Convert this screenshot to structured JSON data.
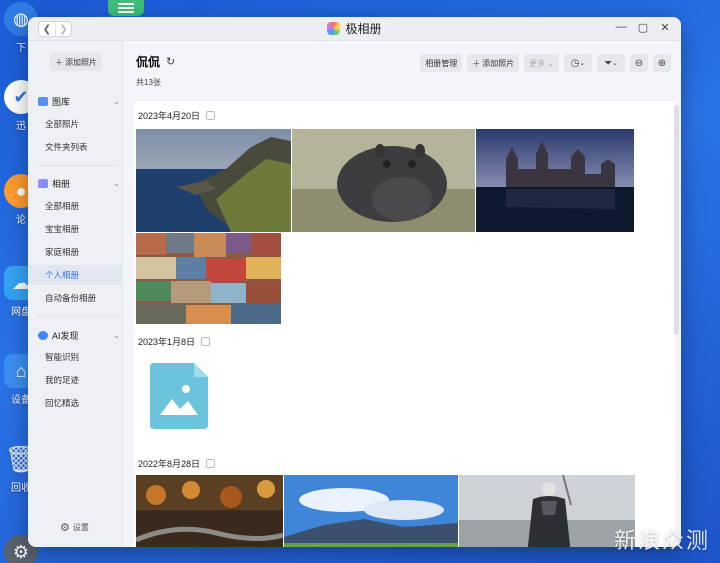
{
  "desktop": {
    "icons": [
      {
        "label": "下"
      },
      {
        "label": "迅"
      },
      {
        "label": "论"
      },
      {
        "label": "网盘"
      },
      {
        "label": "设备"
      },
      {
        "label": "回收"
      }
    ]
  },
  "window": {
    "title": "极相册",
    "controls": {
      "minimize": "—",
      "maximize": "▢",
      "close": "✕"
    }
  },
  "sidebar": {
    "add_photo": "添加照片",
    "gallery": {
      "title": "图库",
      "items": [
        "全部照片",
        "文件夹列表"
      ]
    },
    "albums": {
      "title": "相册",
      "items": [
        "全部相册",
        "宝宝相册",
        "家庭相册",
        "个人相册",
        "自动备份相册"
      ],
      "active": "个人相册"
    },
    "ai": {
      "title": "AI发现",
      "items": [
        "智能识别",
        "我的足迹",
        "回忆精选"
      ]
    },
    "settings": "设置"
  },
  "main": {
    "album_title": "侃侃",
    "count": "共13张",
    "toolbar": {
      "manage": "相册管理",
      "add_photo": "添加照片",
      "more": "更多"
    },
    "groups": [
      {
        "date": "2023年4月20日"
      },
      {
        "date": "2023年1月8日"
      },
      {
        "date": "2022年8月28日"
      }
    ]
  },
  "watermark": "新浪众测",
  "colors": {
    "accent": "#2f6bff",
    "desktop": "#2a73e8"
  }
}
